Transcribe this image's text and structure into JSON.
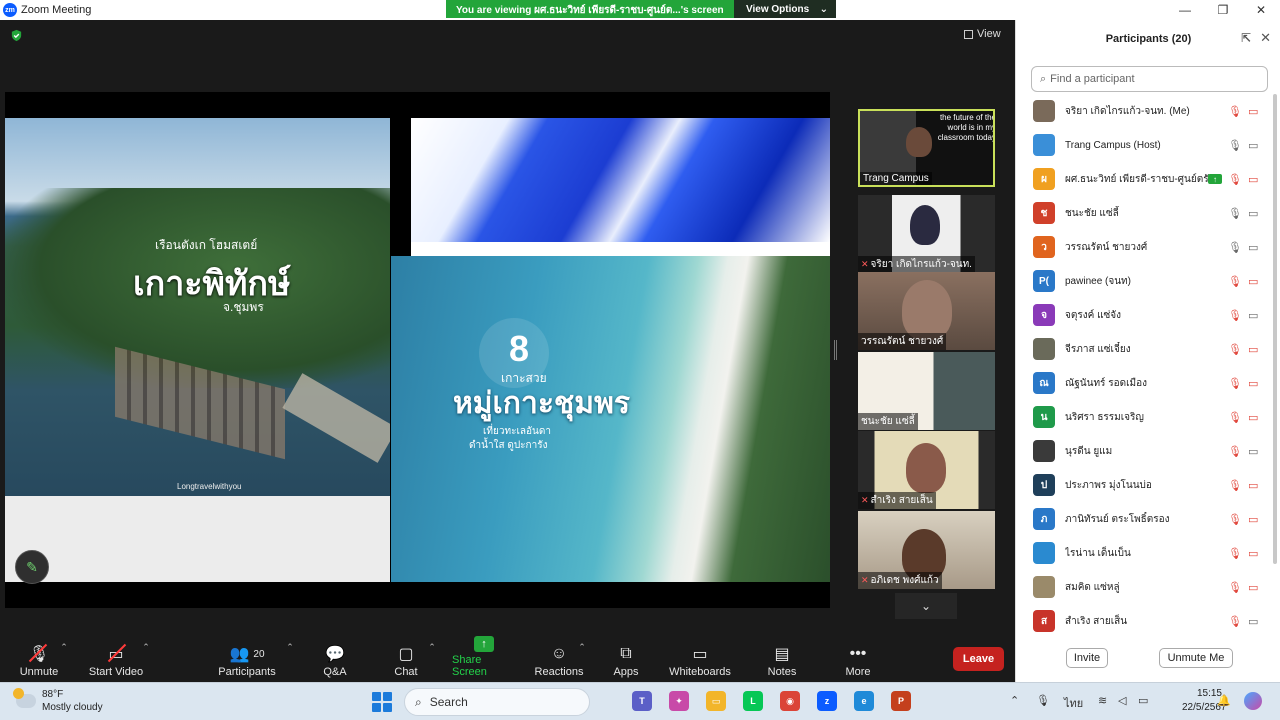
{
  "window": {
    "app_title": "Zoom Meeting",
    "logo_text": "zm",
    "share_banner": "You are viewing ผศ.ธนะวิทย์ เพียรดี-ราชบ-ศูนย์ต...'s screen",
    "view_options": "View Options",
    "view_button": "View"
  },
  "slides": {
    "left_sub1": "เรือนตังเก โฮมสเตย์",
    "left_title": "เกาะพิทักษ์",
    "left_sub2": "จ.ชุมพร",
    "left_credit": "Longtravelwithyou",
    "right_number": "8",
    "right_kasuay": "เกาะสวย",
    "right_main": "หมู่เกาะชุมพร",
    "right_line1": "เที่ยวทะเลอันดา",
    "right_line2": "ดำน้ำใส ดูปะการัง"
  },
  "thumbnails": [
    {
      "name": "Trang Campus",
      "muted": false,
      "board_text": "the future of the world is in my classroom today"
    },
    {
      "name": "จริยา เกิดไกรแก้ว-จนท.",
      "muted": true
    },
    {
      "name": "วรรณรัตน์ ชายวงศ์",
      "muted": false
    },
    {
      "name": "ชนะชัย แซ่ลี้",
      "muted": false
    },
    {
      "name": "สำเริง สายเส็น",
      "muted": true
    },
    {
      "name": "อภิเดช พงศ์แก้ว",
      "muted": true
    }
  ],
  "toolbar": {
    "unmute": "Unmute",
    "start_video": "Start Video",
    "participants": "Participants",
    "participants_count": "20",
    "qa": "Q&A",
    "chat": "Chat",
    "share_screen": "Share Screen",
    "reactions": "Reactions",
    "apps": "Apps",
    "whiteboards": "Whiteboards",
    "notes": "Notes",
    "more": "More",
    "leave": "Leave"
  },
  "panel": {
    "title": "Participants (20)",
    "search_placeholder": "Find a participant",
    "invite": "Invite",
    "unmute_me": "Unmute Me",
    "participants": [
      {
        "name": "จริยา เกิดไกรแก้ว-จนท. (Me)",
        "initial": "",
        "color": "#7a6a5a",
        "mic": "off",
        "cam": "off",
        "sharing": false
      },
      {
        "name": "Trang Campus (Host)",
        "initial": "",
        "color": "#3a8fd8",
        "mic": "on",
        "cam": "on",
        "sharing": false
      },
      {
        "name": "ผศ.ธนะวิทย์ เพียรดี-ราชบ-ศูนย์ตรัง",
        "initial": "ผ",
        "color": "#f0a020",
        "mic": "off",
        "cam": "off",
        "sharing": true
      },
      {
        "name": "ชนะชัย แซ่ลี้",
        "initial": "ช",
        "color": "#d0402a",
        "mic": "on",
        "cam": "on",
        "sharing": false
      },
      {
        "name": "วรรณรัตน์ ชายวงศ์",
        "initial": "ว",
        "color": "#e0641e",
        "mic": "on",
        "cam": "on",
        "sharing": false
      },
      {
        "name": "pawinee (จนท)",
        "initial": "P(",
        "color": "#2a78c8",
        "mic": "off",
        "cam": "off",
        "sharing": false
      },
      {
        "name": "จตุรงค์ แซ่จัง",
        "initial": "จ",
        "color": "#8a3ab8",
        "mic": "off",
        "cam": "on",
        "sharing": false
      },
      {
        "name": "จีรภาส แซ่เจี๋ยง",
        "initial": "",
        "color": "#6a6a5a",
        "mic": "off",
        "cam": "off",
        "sharing": false
      },
      {
        "name": "ณัฐนันทร์ รอดเมือง",
        "initial": "ณ",
        "color": "#2a78c8",
        "mic": "off",
        "cam": "off",
        "sharing": false
      },
      {
        "name": "นริศรา ธรรมเจริญ",
        "initial": "น",
        "color": "#1f9a4a",
        "mic": "off",
        "cam": "off",
        "sharing": false
      },
      {
        "name": "นุรดีน ยูแม",
        "initial": "",
        "color": "#3a3a3a",
        "mic": "off",
        "cam": "on",
        "sharing": false
      },
      {
        "name": "ประภาพร มุ่งโนนบ่อ",
        "initial": "ป",
        "color": "#1f3f5a",
        "mic": "off",
        "cam": "off",
        "sharing": false
      },
      {
        "name": "ภานิทัรนย์ ตระโพธิ์ตรอง",
        "initial": "ภ",
        "color": "#2a78c8",
        "mic": "off",
        "cam": "off",
        "sharing": false
      },
      {
        "name": "ไรน่าน เด็นเบ็น",
        "initial": "",
        "color": "#2a8ad0",
        "mic": "off",
        "cam": "off",
        "sharing": false
      },
      {
        "name": "สมคิด แซ่หลู่",
        "initial": "",
        "color": "#9a8a6a",
        "mic": "off",
        "cam": "off",
        "sharing": false
      },
      {
        "name": "สำเริง สายเส็น",
        "initial": "ส",
        "color": "#c8342a",
        "mic": "off",
        "cam": "on",
        "sharing": false
      }
    ]
  },
  "taskbar": {
    "temperature": "88°F",
    "weather": "Mostly cloudy",
    "search": "Search",
    "language": "ไทย",
    "time": "15:15",
    "date": "22/5/2567",
    "apps": [
      {
        "icon": "teams-icon",
        "color": "#5b5fc7",
        "glyph": "T"
      },
      {
        "icon": "copilot-icon",
        "color": "#c84aa8",
        "glyph": "✦"
      },
      {
        "icon": "file-explorer-icon",
        "color": "#f2b52a",
        "glyph": "▭"
      },
      {
        "icon": "line-icon",
        "color": "#06c755",
        "glyph": "L"
      },
      {
        "icon": "chrome-icon",
        "color": "#db4437",
        "glyph": "◉"
      },
      {
        "icon": "zoom-icon",
        "color": "#0b5cff",
        "glyph": "z"
      },
      {
        "icon": "edge-icon",
        "color": "#1f8ad8",
        "glyph": "e"
      },
      {
        "icon": "powerpoint-icon",
        "color": "#c4401d",
        "glyph": "P"
      }
    ]
  }
}
